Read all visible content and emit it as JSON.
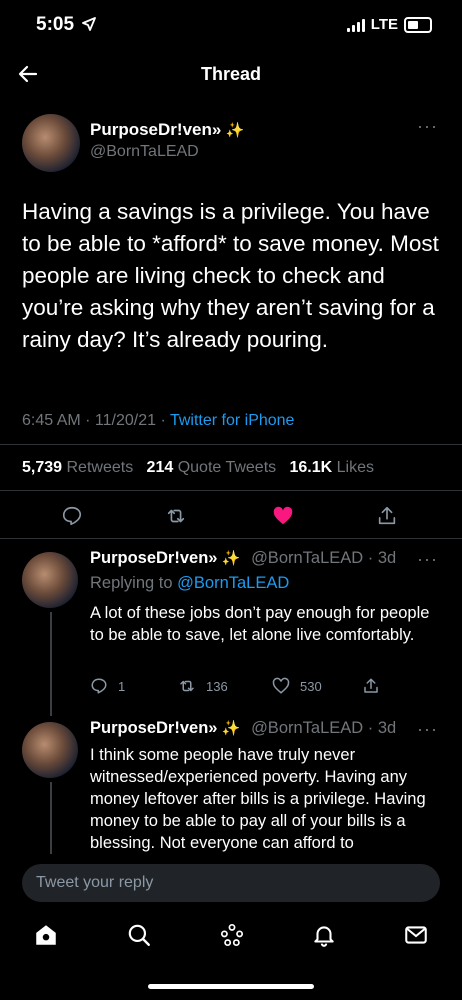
{
  "status_bar": {
    "time": "5:05",
    "network": "LTE"
  },
  "header": {
    "title": "Thread"
  },
  "main_tweet": {
    "display_name": "PurposeDr!ven»",
    "name_emoji": "✨",
    "handle": "@BornTaLEAD",
    "text": "Having a savings is a privilege. You have to be able to *afford* to save money. Most people are living check to check and you’re asking why they aren’t saving for a rainy day? It’s already pouring.",
    "time": "6:45 AM",
    "date": "11/20/21",
    "source": "Twitter for iPhone",
    "retweets_count": "5,739",
    "retweets_label": "Retweets",
    "quotes_count": "214",
    "quotes_label": "Quote Tweets",
    "likes_count": "16.1K",
    "likes_label": "Likes"
  },
  "replies": [
    {
      "display_name": "PurposeDr!ven»",
      "name_emoji": "✨",
      "handle_time": "@BornTaLEAD · 3d",
      "replying_prefix": "Replying to",
      "replying_handle": "@BornTaLEAD",
      "text": "A lot of these jobs don’t pay enough for people to be able to save, let alone live comfortably.",
      "reply_count": "1",
      "retweet_count": "136",
      "like_count": "530"
    },
    {
      "display_name": "PurposeDr!ven»",
      "name_emoji": "✨",
      "handle_time": "@BornTaLEAD · 3d",
      "text": "I think some people have truly never witnessed/experienced poverty. Having any money leftover after bills is a privilege. Having money to be able to pay all of your bills is a blessing. Not everyone can afford to"
    }
  ],
  "compose": {
    "placeholder": "Tweet your reply"
  },
  "colors": {
    "accent": "#1d9bf0",
    "like": "#f91880",
    "background": "#000000"
  },
  "icons": [
    "back-arrow-icon",
    "more-icon",
    "reply-icon",
    "retweet-icon",
    "heart-icon",
    "share-icon",
    "home-icon",
    "search-icon",
    "spaces-icon",
    "notifications-icon",
    "messages-icon"
  ]
}
